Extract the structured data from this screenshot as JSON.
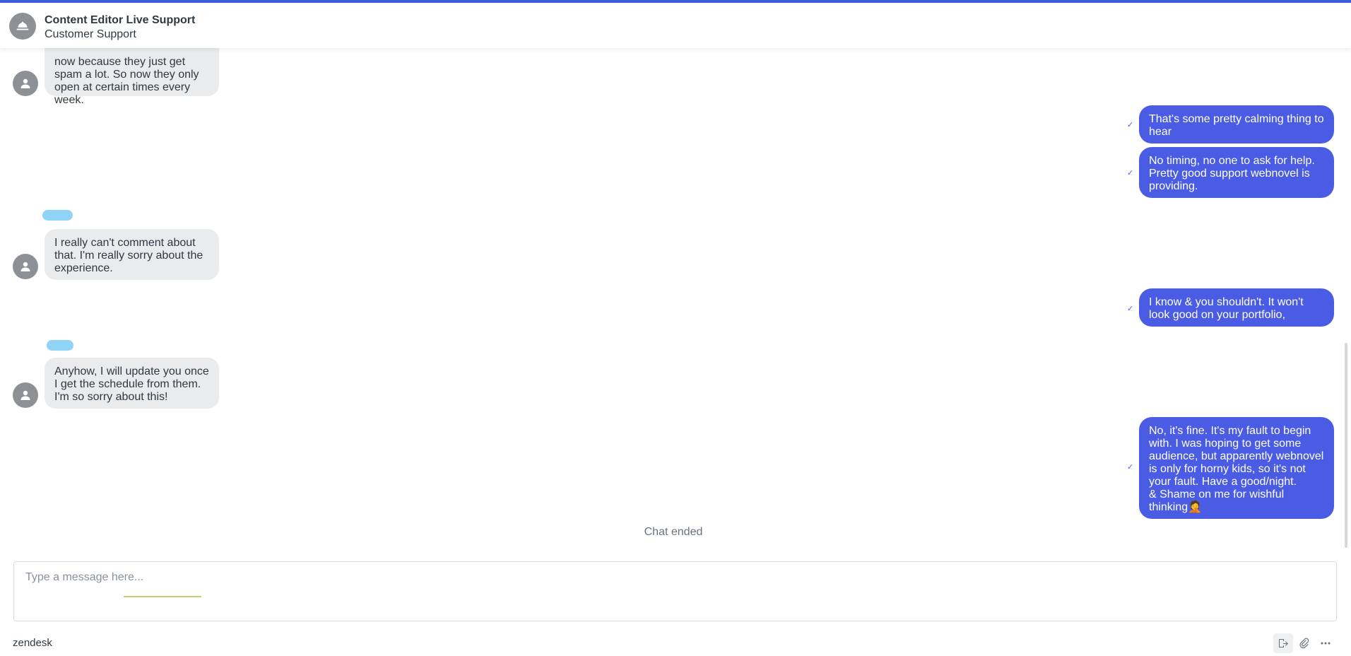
{
  "header": {
    "title": "Content Editor Live Support",
    "subtitle": "Customer Support",
    "avatar_icon": "concierge-bell-icon"
  },
  "messages": [
    {
      "from": "agent",
      "text": "now because they just get spam a lot. So now they only open at certain times every week."
    },
    {
      "from": "visitor",
      "text": "That's some pretty calming thing to hear"
    },
    {
      "from": "visitor",
      "text": "No timing, no one to ask for help. Pretty good support webnovel is providing."
    },
    {
      "from": "agent",
      "text": "I really can't comment about that. I'm really sorry about the experience."
    },
    {
      "from": "visitor",
      "text": "I know & you shouldn't. It won't look good on your portfolio,"
    },
    {
      "from": "agent",
      "text": "Anyhow, I will update you once I get the schedule from them. I'm so sorry about this!"
    },
    {
      "from": "visitor",
      "text": "No, it's fine. It's my fault to begin with. I was hoping to get some audience, but apparently webnovel is only for horny kids, so it's not your fault. Have a good/night.\n& Shame on me for wishful thinking🤦"
    }
  ],
  "status": {
    "chat_ended": "Chat ended",
    "read_mark": "✓"
  },
  "composer": {
    "placeholder": "Type a message here...",
    "value": ""
  },
  "footer": {
    "brand": "zendesk",
    "icons": [
      "end-chat-icon",
      "attachment-icon",
      "more-options-icon"
    ]
  },
  "colors": {
    "accent": "#3f5bd9",
    "visitor_bubble": "#4a5be4",
    "agent_bubble": "#e9ebed",
    "avatar": "#8d9196"
  }
}
